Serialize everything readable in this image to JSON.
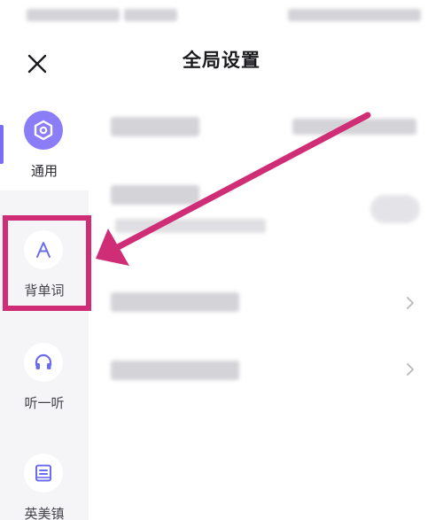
{
  "header": {
    "title": "全局设置"
  },
  "sidebar": {
    "items": [
      {
        "label": "通用",
        "icon": "settings-hexagon-icon",
        "active": true
      },
      {
        "label": "背单词",
        "icon": "letter-a-icon",
        "active": false
      },
      {
        "label": "听一听",
        "icon": "headphones-icon",
        "active": false
      },
      {
        "label": "英美镇",
        "icon": "book-icon",
        "active": false
      }
    ]
  },
  "colors": {
    "accent": "#7b6cf6",
    "highlight": "#cf2d75",
    "sidebar_bg": "#f5f5f7"
  }
}
